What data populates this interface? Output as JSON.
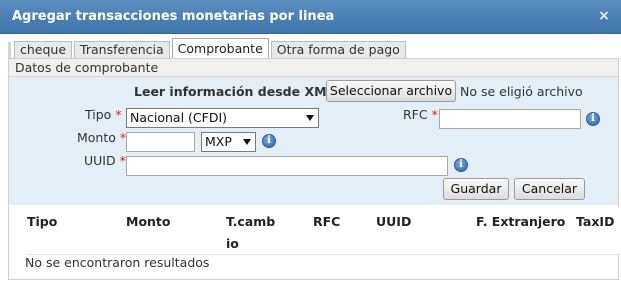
{
  "window": {
    "title": "Agregar transacciones monetarias por linea",
    "close_glyph": "×"
  },
  "tabs": [
    {
      "label": "cheque",
      "active": false
    },
    {
      "label": "Transferencia",
      "active": false
    },
    {
      "label": "Comprobante",
      "active": true
    },
    {
      "label": "Otra forma de pago",
      "active": false
    }
  ],
  "section": {
    "title": "Datos de comprobante"
  },
  "xml": {
    "label": "Leer información desde XML",
    "button": "Seleccionar archivo",
    "status": "No se eligió archivo"
  },
  "form": {
    "tipo": {
      "label": "Tipo",
      "required": "*",
      "value": "Nacional (CFDI)"
    },
    "rfc": {
      "label": "RFC",
      "required": "*",
      "value": ""
    },
    "monto": {
      "label": "Monto",
      "required": "*",
      "value": "",
      "currency": "MXP"
    },
    "uuid": {
      "label": "UUID",
      "required": "*",
      "value": ""
    },
    "info_glyph": "i"
  },
  "actions": {
    "save": "Guardar",
    "cancel": "Cancelar"
  },
  "table": {
    "columns": [
      "Tipo",
      "Monto",
      "T.camb",
      "RFC",
      "UUID",
      "F. Extranjero",
      "TaxID"
    ],
    "column_wrap": "io",
    "empty_message": "No se encontraron resultados"
  },
  "colors": {
    "titlebar": "#4a80b8",
    "form_bg": "#e4eef7",
    "required": "#dd2222",
    "info_icon": "#2f66a8"
  }
}
